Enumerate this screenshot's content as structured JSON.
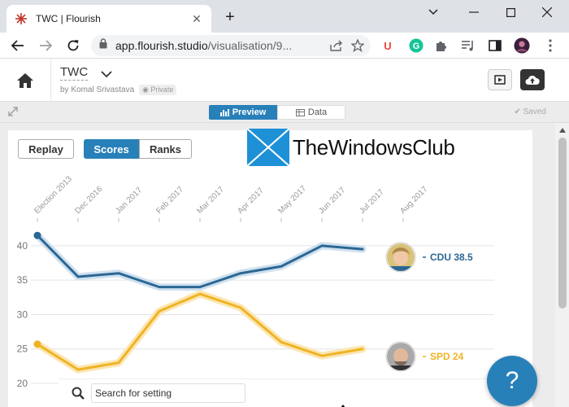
{
  "browser": {
    "tab_title": "TWC | Flourish",
    "url_host": "app.flourish.studio",
    "url_path": "/visualisation/9..."
  },
  "header": {
    "vis_title": "TWC",
    "byline": "by Komal Srivastava",
    "privacy": "Private"
  },
  "subbar": {
    "preview_label": "Preview",
    "data_label": "Data",
    "saved_label": "Saved"
  },
  "controls": {
    "replay": "Replay",
    "scores": "Scores",
    "ranks": "Ranks"
  },
  "watermark": "TheWindowsClub",
  "search": {
    "placeholder": "Search for setting"
  },
  "help": "?",
  "colors": {
    "accent": "#2880b9",
    "cdu": "#2b6794",
    "spd": "#f0b323"
  },
  "chart_data": {
    "type": "line",
    "x": [
      "Election 2013",
      "Dec 2016",
      "Jan 2017",
      "Feb 2017",
      "Mar 2017",
      "Apr 2017",
      "May 2017",
      "Jun 2017",
      "Jul 2017",
      "Aug 2017"
    ],
    "ylim": [
      20,
      42
    ],
    "yticks": [
      20,
      25,
      30,
      35,
      40
    ],
    "series": [
      {
        "name": "CDU",
        "label": "CDU 38.5",
        "values": [
          41.5,
          35.5,
          36,
          34,
          34,
          36,
          37,
          40,
          39.5,
          38.5
        ]
      },
      {
        "name": "SPD",
        "label": "SPD 24",
        "values": [
          25.7,
          22,
          23,
          30.5,
          33,
          31,
          26,
          24,
          25,
          24
        ]
      }
    ]
  }
}
